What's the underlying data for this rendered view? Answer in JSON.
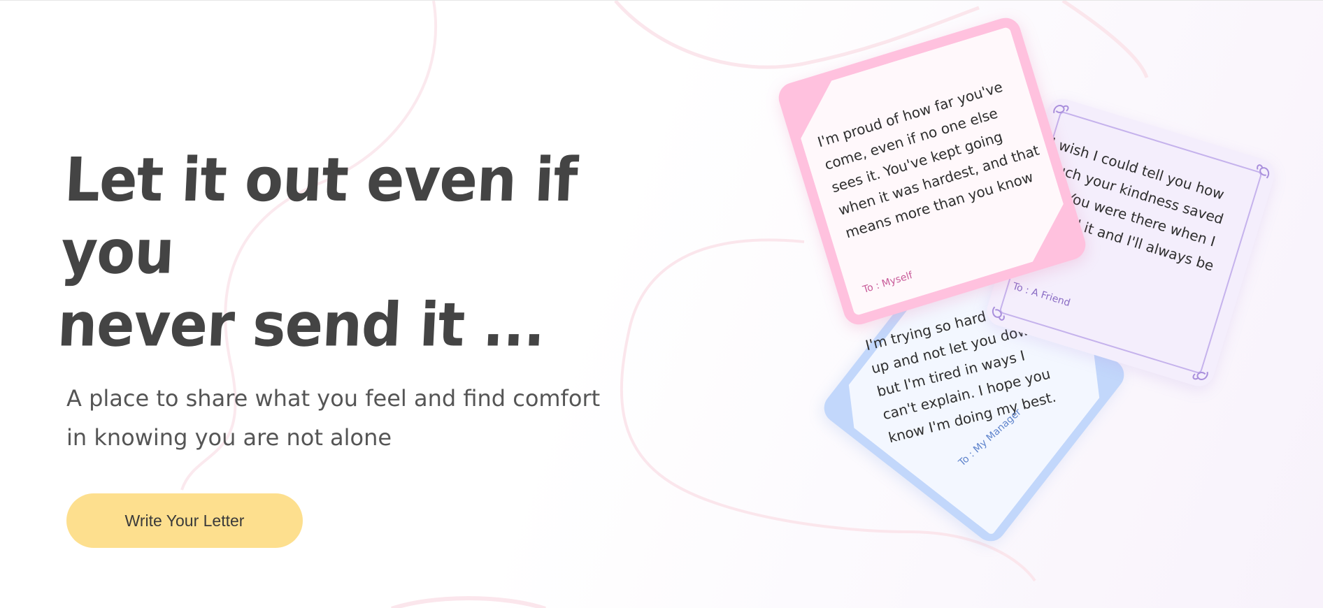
{
  "hero": {
    "headline_line1": "Let it out even if you",
    "headline_line2": "never send it ...",
    "subtitle": "A place to share what you feel and find comfort in knowing you are not alone",
    "cta_label": "Write Your Letter"
  },
  "letters": [
    {
      "body": "I'm proud of how far you've come, even if no one else sees it. You've kept going when it was hardest, and that means more than you know",
      "to": "To : Myself",
      "color": "#ffc1de"
    },
    {
      "body": "I wish I could tell you how much your kindness saved me. You were there when I needed it and I'll always be grateful",
      "to": "To : A Friend",
      "color": "#f4eefc"
    },
    {
      "body": "I'm trying so hard to keep up and not let you down, but I'm tired in ways I can't explain. I hope you know I'm doing my best.",
      "to": "To : My Manager",
      "color": "#c2d7fb"
    }
  ],
  "colors": {
    "heading": "#444444",
    "subtitle": "#555555",
    "cta_bg": "#fddf8e"
  }
}
